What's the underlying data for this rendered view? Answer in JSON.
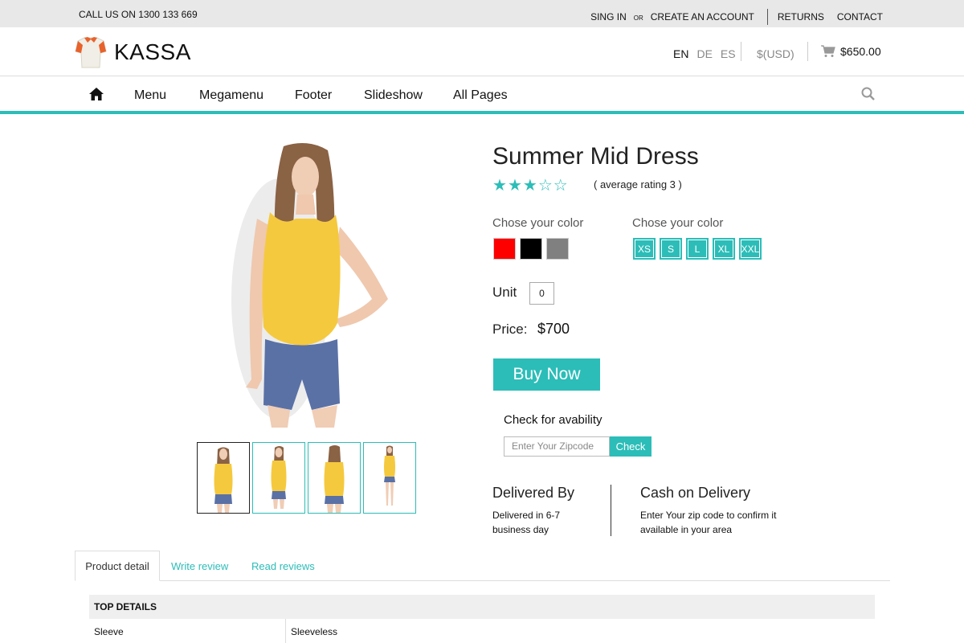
{
  "topbar": {
    "phone": "CALL US ON 1300 133 669",
    "sign_in": "SING IN",
    "or": "OR",
    "create_account": "CREATE AN ACCOUNT",
    "returns": "RETURNS",
    "contact": "CONTACT"
  },
  "header": {
    "logo_text": "KASSA",
    "languages": [
      "EN",
      "DE",
      "ES"
    ],
    "active_language": "EN",
    "currency": "$(USD)",
    "cart_total": "$650.00"
  },
  "nav": {
    "home_icon": "home-icon",
    "items": [
      "Menu",
      "Megamenu",
      "Footer",
      "Slideshow",
      "All Pages"
    ],
    "search_icon": "search-icon"
  },
  "product": {
    "title": "Summer Mid Dress",
    "rating": 3,
    "rating_max": 5,
    "rating_text": "( average rating 3 )",
    "color_label": "Chose your color",
    "colors": [
      "#ff0000",
      "#000000",
      "#808080"
    ],
    "size_label": "Chose your color",
    "sizes": [
      "XS",
      "S",
      "L",
      "XL",
      "XXL"
    ],
    "unit_label": "Unit",
    "unit_value": "0",
    "price_label": "Price:",
    "price_value": "$700",
    "buy_label": "Buy Now",
    "thumbnails": 4,
    "active_thumbnail": 0
  },
  "availability": {
    "title": "Check for avability",
    "zip_placeholder": "Enter Your Zipcode",
    "check_label": "Check"
  },
  "delivery": {
    "title": "Delivered By",
    "text": "Delivered in 6-7 business day"
  },
  "cod": {
    "title": "Cash on Delivery",
    "text": "Enter Your zip code to confirm it available in your area"
  },
  "tabs": {
    "items": [
      "Product detail",
      "Write review",
      "Read reviews"
    ],
    "active": "Product detail"
  },
  "details": {
    "heading": "TOP DETAILS",
    "rows": [
      {
        "key": "Sleeve",
        "value": "Sleeveless"
      }
    ]
  },
  "colors": {
    "accent": "#2cbdb8",
    "topbar_bg": "#e8e8e8"
  }
}
